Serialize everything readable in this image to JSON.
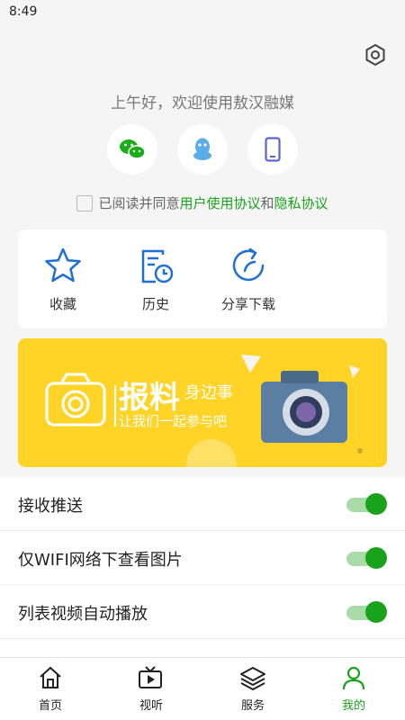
{
  "status": {
    "time": "8:49"
  },
  "greeting": "上午好，欢迎使用敖汉融媒",
  "login": {
    "icons": [
      "wechat-icon",
      "qq-icon",
      "phone-icon"
    ],
    "colors": {
      "wechat": "#1aad19",
      "qq": "#5aaee8",
      "phone": "#5b63d6"
    }
  },
  "agreement": {
    "prefix": "已阅读并同意",
    "user_agreement": "用户使用协议",
    "and": "和",
    "privacy": "隐私协议",
    "checked": false
  },
  "quick_actions": [
    {
      "label": "收藏",
      "icon": "star-icon"
    },
    {
      "label": "历史",
      "icon": "history-icon"
    },
    {
      "label": "分享下载",
      "icon": "share-icon"
    }
  ],
  "banner": {
    "title": "报料",
    "subtitle1": "身边事",
    "subtitle2": "让我们一起参与吧"
  },
  "settings": [
    {
      "label": "接收推送",
      "enabled": true
    },
    {
      "label": "仅WIFI网络下查看图片",
      "enabled": true
    },
    {
      "label": "列表视频自动播放",
      "enabled": true
    }
  ],
  "tabs": [
    {
      "label": "首页",
      "icon": "home-icon",
      "active": false
    },
    {
      "label": "视听",
      "icon": "video-icon",
      "active": false
    },
    {
      "label": "服务",
      "icon": "layers-icon",
      "active": false
    },
    {
      "label": "我的",
      "icon": "user-icon",
      "active": true
    }
  ],
  "colors": {
    "accent": "#19a31c",
    "banner": "#ffd426",
    "icon_blue": "#1e6fd6"
  }
}
